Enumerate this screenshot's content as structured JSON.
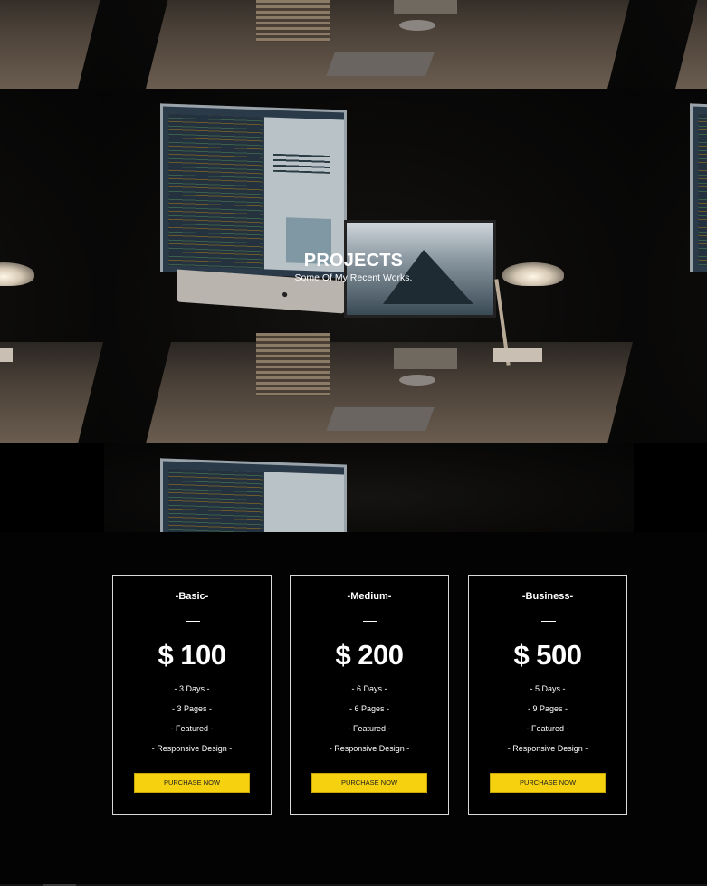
{
  "hero": {
    "title": "PROJECTS",
    "subtitle": "Some Of My Recent Works.",
    "image_description_icon": "desk-setup-image"
  },
  "pricing": {
    "plans": [
      {
        "name": "-Basic-",
        "price": "$ 100",
        "features": [
          "- 3 Days -",
          "- 3 Pages -",
          "- Featured -",
          "- Responsive Design -"
        ],
        "button": "PURCHASE NOW"
      },
      {
        "name": "-Medium-",
        "price": "$ 200",
        "features": [
          "- 6 Days -",
          "- 6 Pages -",
          "- Featured -",
          "- Responsive Design -"
        ],
        "button": "PURCHASE NOW"
      },
      {
        "name": "-Business-",
        "price": "$ 500",
        "features": [
          "- 5 Days -",
          "- 9 Pages -",
          "- Featured -",
          "- Responsive Design -"
        ],
        "button": "PURCHASE NOW"
      }
    ]
  },
  "colors": {
    "background": "#000000",
    "accent": "#f5d10f",
    "text": "#ffffff"
  }
}
